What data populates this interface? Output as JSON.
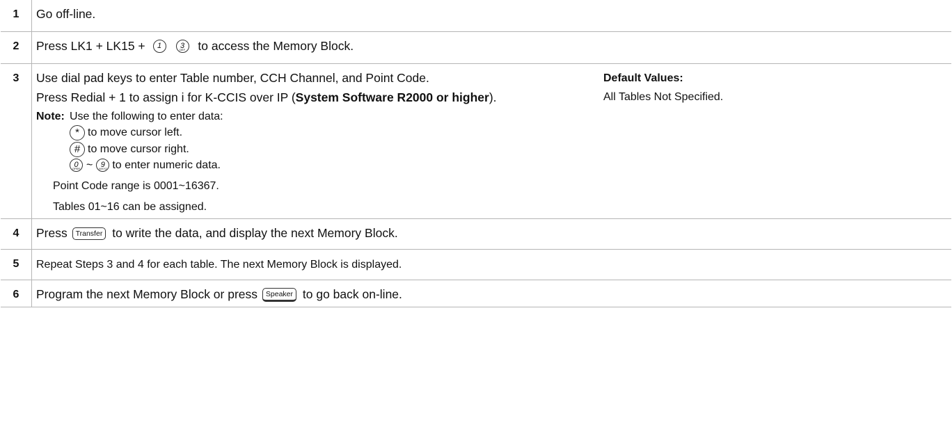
{
  "steps": [
    {
      "num": "1",
      "text": "Go off-line."
    },
    {
      "num": "2",
      "pre": "Press LK1 + LK15 +",
      "keys": [
        {
          "digit": "1",
          "sub": ""
        },
        {
          "digit": "3",
          "sub": "DEF"
        }
      ],
      "post": "to access the Memory Block."
    },
    {
      "num": "3",
      "line1": "Use dial pad keys to enter Table number, CCH Channel, and Point Code.",
      "line2_pre": "Press Redial + 1 to assign i for K-CCIS over IP (",
      "line2_bold": "System Software R2000 or higher",
      "line2_post": ").",
      "note_label": "Note:",
      "note_intro": "Use the following to enter data:",
      "note_star": "to move cursor left.",
      "note_hash": "to move cursor right.",
      "note_range_sep": "~",
      "note_numeric": "to enter numeric data.",
      "note_point_code": "Point Code range is 0001~16367.",
      "note_tables": "Tables 01~16 can be assigned.",
      "default_label": "Default Values:",
      "default_value": "All Tables Not Specified.",
      "keys": {
        "star": "*",
        "hash": "#",
        "zero": "0",
        "zero_sub": "OPER",
        "nine": "9",
        "nine_sub": "WXYZ"
      }
    },
    {
      "num": "4",
      "pre": "Press",
      "button": "Transfer",
      "post": "to write the data, and display the next Memory Block."
    },
    {
      "num": "5",
      "text": "Repeat Steps 3 and 4 for each table. The next Memory Block is displayed."
    },
    {
      "num": "6",
      "pre": "Program the next Memory Block or press",
      "button": "Speaker",
      "post": "to go back on-line."
    }
  ]
}
